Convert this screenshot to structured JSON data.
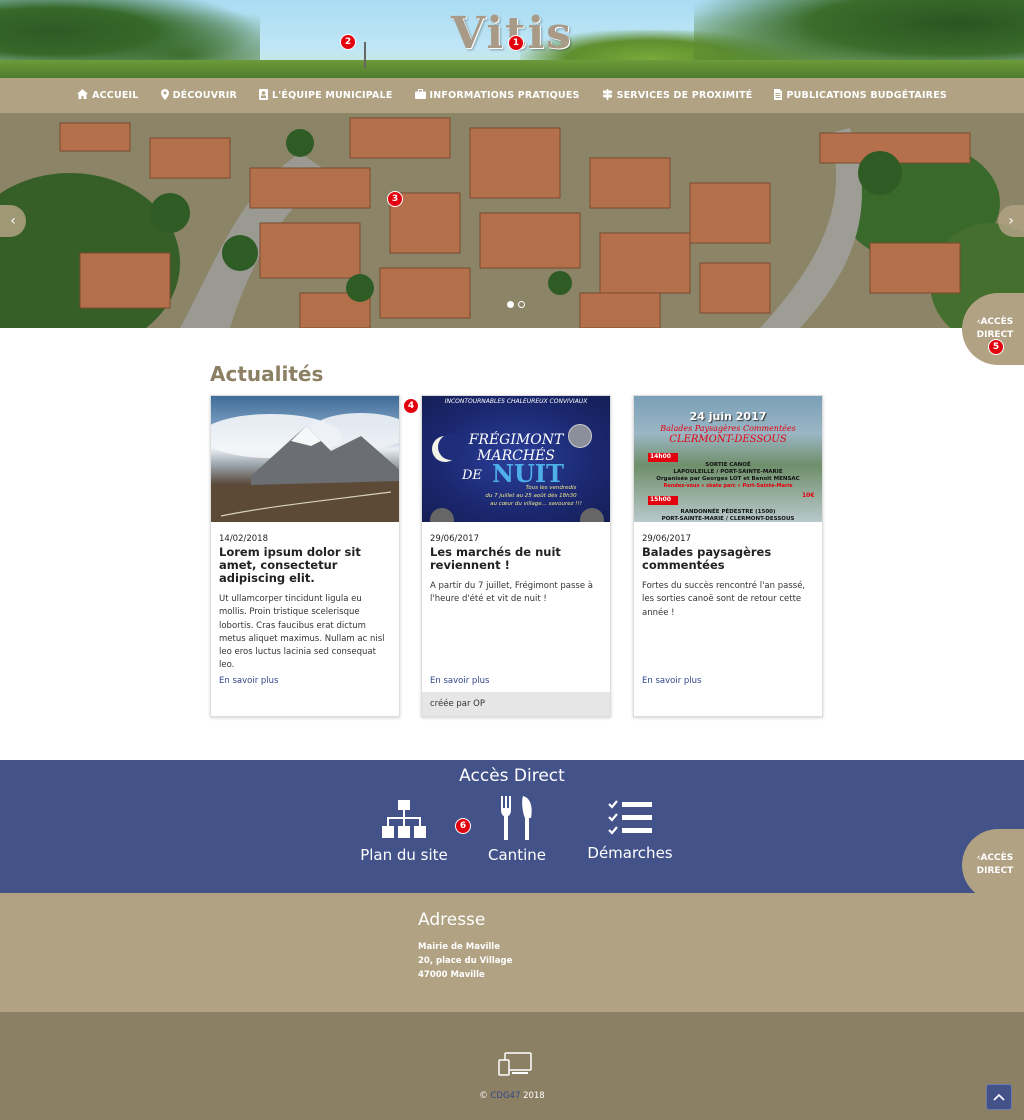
{
  "header": {
    "logo_text": "Vitis"
  },
  "nav": {
    "items": [
      {
        "icon": "home-icon",
        "label": "ACCUEIL"
      },
      {
        "icon": "map-marker-icon",
        "label": "DÉCOUVRIR"
      },
      {
        "icon": "id-card-icon",
        "label": "L'ÉQUIPE MUNICIPALE"
      },
      {
        "icon": "briefcase-icon",
        "label": "INFORMATIONS PRATIQUES"
      },
      {
        "icon": "signpost-icon",
        "label": "SERVICES DE PROXIMITÉ"
      },
      {
        "icon": "document-icon",
        "label": "PUBLICATIONS BUDGÉTAIRES"
      }
    ]
  },
  "slider": {
    "prev_arrow": "‹",
    "next_arrow": "›",
    "slide_count": 2,
    "active_slide": 1
  },
  "acces_tab": {
    "chevron": "‹",
    "line1": "ACCÈS",
    "line2": "DIRECT"
  },
  "badges": [
    "1",
    "2",
    "3",
    "4",
    "5",
    "6"
  ],
  "actualites": {
    "title": "Actualités",
    "cards": [
      {
        "date": "14/02/2018",
        "title": "Lorem ipsum dolor sit amet, consectetur adipiscing elit.",
        "text": "Ut ullamcorper tincidunt ligula eu mollis. Proin tristique scelerisque lobortis. Cras faucibus erat dictum metus aliquet maximus. Nullam ac nisl leo eros luctus lacinia sed consequat leo.",
        "link": "En savoir plus",
        "footer": ""
      },
      {
        "date": "29/06/2017",
        "title": "Les marchés de nuit reviennent !",
        "text": "A partir du 7 juillet, Frégimont passe à l'heure d'été et vit de nuit !",
        "link": "En savoir plus",
        "footer": "créée par OP",
        "poster": {
          "top": "INCONTOURNABLES CHALEUREUX CONVIVIAUX",
          "line1": "FRÉGIMONT",
          "line2": "MARCHÉS",
          "line3": "DE",
          "line4": "NUIT",
          "sub1": "Tous les vendredis",
          "sub2": "du 7 juillet au 25 août dès 18h30",
          "sub3": "au cœur du village... savourez !!!"
        }
      },
      {
        "date": "29/06/2017",
        "title": "Balades paysagères commentées",
        "text": "Fortes du succès rencontré l'an passé, les sorties canoë sont de retour cette année !",
        "link": "En savoir plus",
        "footer": "",
        "poster": {
          "date": "24 juin 2017",
          "title1": "Balades Paysagères Commentées",
          "title2": "CLERMONT-DESSOUS",
          "time1": "14h00",
          "act1": "SORTIE CANOË",
          "act1b": "LAPOULEILLE / PORT-SAINTE-MARIE",
          "act1c": "Organisée par Georges LOT et Benoit MENSAC",
          "act1d": "Rendez-vous « skate parc » Port-Sainte-Marie",
          "price": "10€",
          "time2": "15h00",
          "act2": "RANDONNÉE PÉDESTRE (1500)",
          "act2b": "PORT-SAINTE-MARIE / CLERMONT-DESSOUS"
        }
      }
    ]
  },
  "acces_direct": {
    "title": "Accès Direct",
    "items": [
      {
        "icon": "sitemap-icon",
        "label": "Plan du site"
      },
      {
        "icon": "cutlery-icon",
        "label": "Cantine"
      },
      {
        "icon": "checklist-icon",
        "label": "Démarches"
      }
    ]
  },
  "adresse": {
    "title": "Adresse",
    "lines": [
      "Mairie de Maville",
      "20, place du Village",
      "47000 Maville"
    ]
  },
  "footer": {
    "copyright_symbol": "©",
    "brand": "CDG47",
    "year": "2018",
    "scroll_top": "^"
  }
}
